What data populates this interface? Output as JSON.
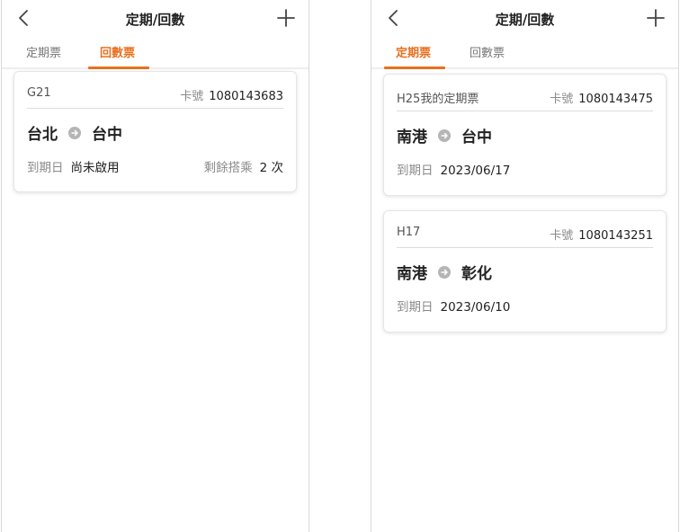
{
  "left": {
    "header": {
      "title": "定期/回數"
    },
    "tabs": [
      {
        "label": "定期票",
        "active": false
      },
      {
        "label": "回數票",
        "active": true
      }
    ],
    "cards": [
      {
        "name": "G21",
        "card_no_label": "卡號",
        "card_no": "1080143683",
        "from": "台北",
        "to": "台中",
        "expiry_label": "到期日",
        "expiry_value": "尚未啟用",
        "remaining_label": "剩餘搭乘",
        "remaining_value": "2 次"
      }
    ]
  },
  "right": {
    "header": {
      "title": "定期/回數"
    },
    "tabs": [
      {
        "label": "定期票",
        "active": true
      },
      {
        "label": "回數票",
        "active": false
      }
    ],
    "cards": [
      {
        "name": "H25我的定期票",
        "card_no_label": "卡號",
        "card_no": "1080143475",
        "from": "南港",
        "to": "台中",
        "expiry_label": "到期日",
        "expiry_value": "2023/06/17"
      },
      {
        "name": "H17",
        "card_no_label": "卡號",
        "card_no": "1080143251",
        "from": "南港",
        "to": "彰化",
        "expiry_label": "到期日",
        "expiry_value": "2023/06/10"
      }
    ]
  },
  "colors": {
    "accent": "#e8701f",
    "text": "#222222",
    "muted": "#8a8a8a"
  },
  "icons": {
    "back": "chevron-left-icon",
    "add": "plus-icon",
    "route_arrow": "arrow-right-circle-icon"
  }
}
